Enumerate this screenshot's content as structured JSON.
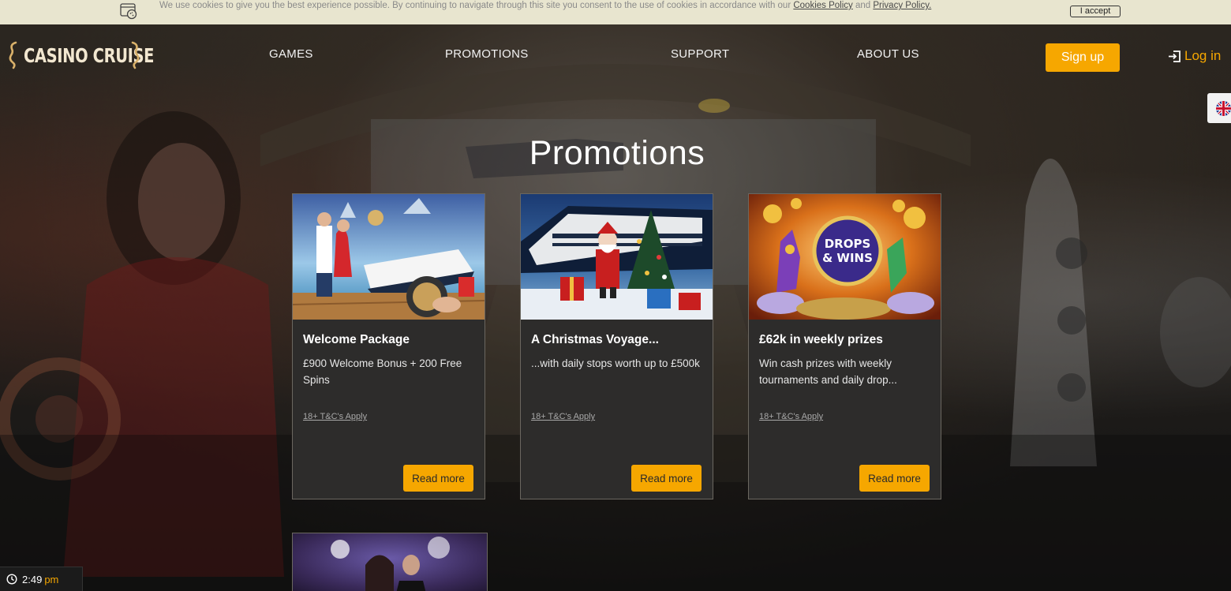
{
  "cookie_bar": {
    "text": "We use cookies to give you the best experience possible. By continuing to navigate through this site you consent to the use of cookies in accordance with our",
    "cookies_policy_link": "Cookies Policy",
    "and": "and",
    "privacy_policy_link": "Privacy Policy.",
    "accept_label": "I accept"
  },
  "header": {
    "logo_text": "CASINO CRUISE",
    "nav": [
      "GAMES",
      "PROMOTIONS",
      "SUPPORT",
      "ABOUT US"
    ],
    "signup_label": "Sign up",
    "login_label": "Log in"
  },
  "page": {
    "title": "Promotions"
  },
  "promotions": [
    {
      "title": "Welcome Package",
      "description": "£900 Welcome Bonus + 200 Free Spins",
      "terms": "18+ T&C's Apply",
      "button": "Read more"
    },
    {
      "title": "A Christmas Voyage...",
      "description": "...with daily stops worth up to £500k",
      "terms": "18+ T&C's Apply",
      "button": "Read more"
    },
    {
      "title": "£62k in weekly prizes",
      "description": "Win cash prizes with weekly tournaments and daily drop...",
      "terms": "18+ T&C's Apply",
      "button": "Read more",
      "image_text_1": "DROPS",
      "image_text_2": "& WINS"
    }
  ],
  "clock": {
    "time": "2:49",
    "ampm": "pm"
  },
  "colors": {
    "accent": "#f6a700",
    "cookie_bar_bg": "#e8e5cf",
    "card_bg": "#2d2c2b"
  },
  "icons": [
    "cookie-icon",
    "seahorse-icon",
    "login-icon",
    "uk-flag-icon",
    "clock-icon"
  ]
}
